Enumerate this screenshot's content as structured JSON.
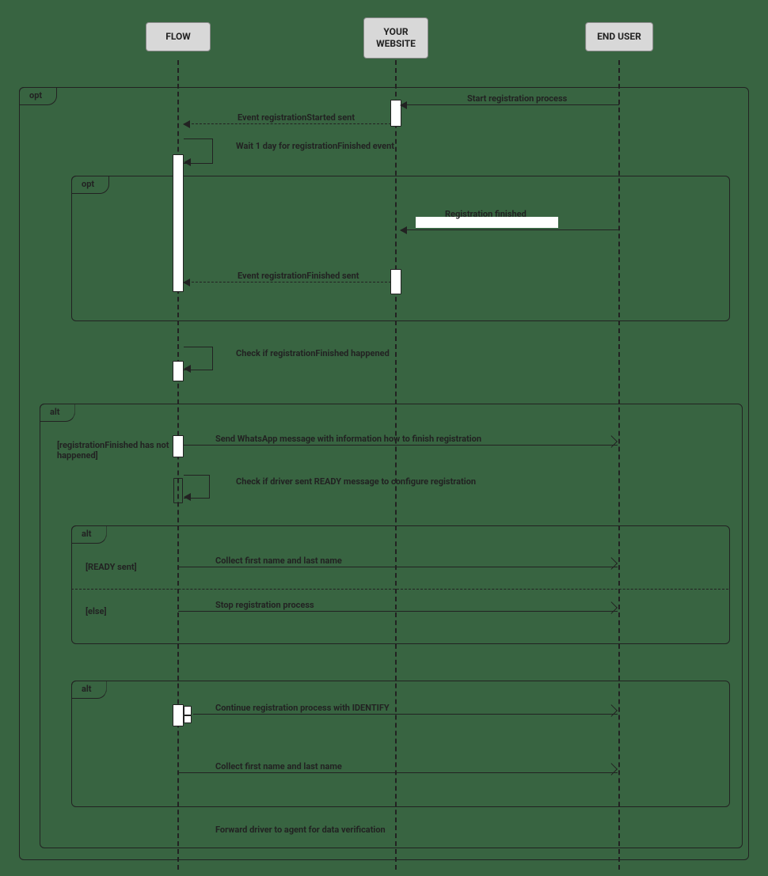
{
  "participants": {
    "flow": "FLOW",
    "website": "YOUR\nWEBSITE",
    "enduser": "END USER"
  },
  "frames": {
    "outer_opt": "opt",
    "inner_opt": "opt",
    "alt1": "alt",
    "alt2": "alt",
    "alt3": "alt"
  },
  "messages": {
    "start_registration": "Start registration process",
    "reg_started_sent": "Event registrationStarted sent",
    "wait_1_day": "Wait 1 day for registrationFinished event",
    "registration_finished": "Registration finished",
    "reg_finished_sent": "Event registrationFinished sent",
    "check_reg_finished": "Check if registrationFinished happened",
    "send_whatsapp": "Send WhatsApp message with information how to finish registration",
    "check_ready": "Check if driver sent READY message to configure registration",
    "collect_name": "Collect first name and last name",
    "stop_registration": "Stop registration process",
    "continue_identify": "Continue registration process with IDENTIFY",
    "collect_name2": "Collect first name and last name",
    "forward_agent": "Forward driver to agent for data verification"
  },
  "guards": {
    "reg_not_happened": "[registrationFinished has not happened]",
    "ready_sent": "[READY sent]",
    "else": "[else]"
  }
}
